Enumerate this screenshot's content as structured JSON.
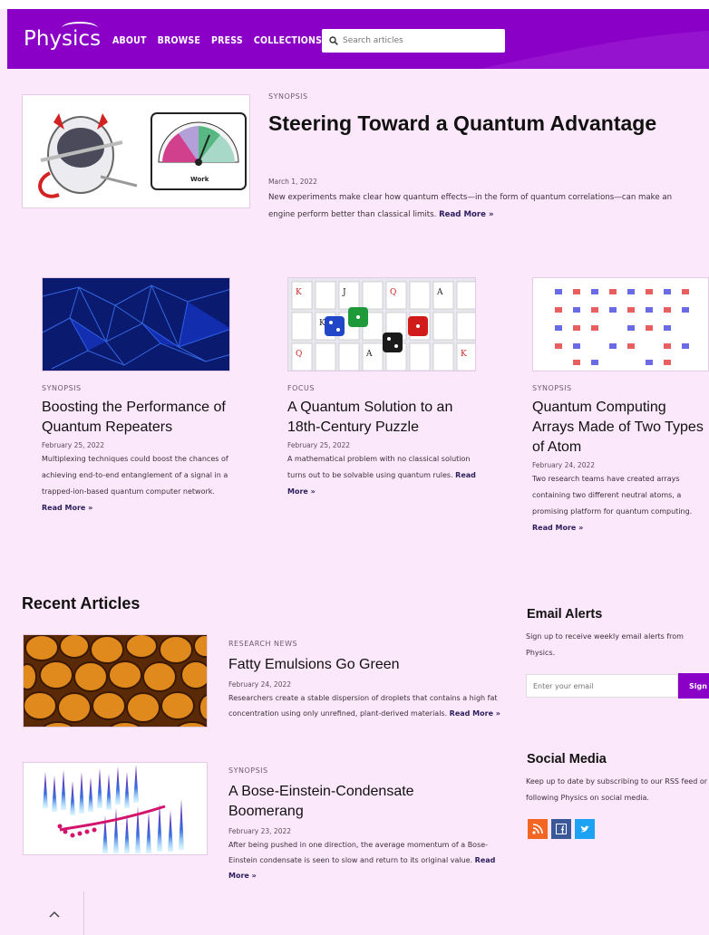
{
  "header": {
    "logo": "Physics",
    "nav": [
      "ABOUT",
      "BROWSE",
      "PRESS",
      "COLLECTIONS"
    ],
    "search_placeholder": "Search articles"
  },
  "hero": {
    "kicker": "SYNOPSIS",
    "title": "Steering Toward a Quantum Advantage",
    "date": "March 1, 2022",
    "desc": "New experiments make clear how quantum effects—in the form of quantum correlations—can make an engine perform better than classical limits.",
    "read_more": "Read More »",
    "gauge_label": "Work"
  },
  "cards": [
    {
      "kicker": "SYNOPSIS",
      "title": "Boosting the Performance of Quantum Repeaters",
      "date": "February 25, 2022",
      "desc": "Multiplexing techniques could boost the chances of achieving end-to-end entanglement of a signal in a trapped-ion-based quantum computer network.",
      "read_more": "Read More »"
    },
    {
      "kicker": "FOCUS",
      "title": "A Quantum Solution to an 18th-Century Puzzle",
      "date": "February 25, 2022",
      "desc": "A mathematical problem with no classical solution turns out to be solvable using quantum rules.",
      "read_more": "Read More »"
    },
    {
      "kicker": "SYNOPSIS",
      "title": "Quantum Computing Arrays Made of Two Types of Atom",
      "date": "February 24, 2022",
      "desc": "Two research teams have created arrays containing two different neutral atoms, a promising platform for quantum computing.",
      "read_more": "Read More »"
    }
  ],
  "recent": {
    "heading": "Recent Articles",
    "items": [
      {
        "kicker": "RESEARCH NEWS",
        "title": "Fatty Emulsions Go Green",
        "date": "February 24, 2022",
        "desc": "Researchers create a stable dispersion of droplets that contains a high fat concentration using only unrefined, plant-derived materials.",
        "read_more": "Read More »"
      },
      {
        "kicker": "SYNOPSIS",
        "title": "A Bose-Einstein-Condensate Boomerang",
        "date": "February 23, 2022",
        "desc": "After being pushed in one direction, the average momentum of a Bose-Einstein condensate is seen to slow and return to its original value.",
        "read_more": "Read More »"
      }
    ]
  },
  "sidebar": {
    "email_heading": "Email Alerts",
    "email_text": "Sign up to receive weekly email alerts from Physics.",
    "email_placeholder": "Enter your email",
    "signup_label": "Sign",
    "social_heading": "Social Media",
    "social_text": "Keep up to date by subscribing to our RSS feed or following Physics on social media.",
    "social_icons": [
      "rss-icon",
      "facebook-icon",
      "twitter-icon"
    ],
    "social_colors": [
      "#f26522",
      "#3b5998",
      "#1da1f2"
    ]
  },
  "back_to_top": "^",
  "colors": {
    "brand": "#8a00c6",
    "background": "#fce8fb"
  }
}
